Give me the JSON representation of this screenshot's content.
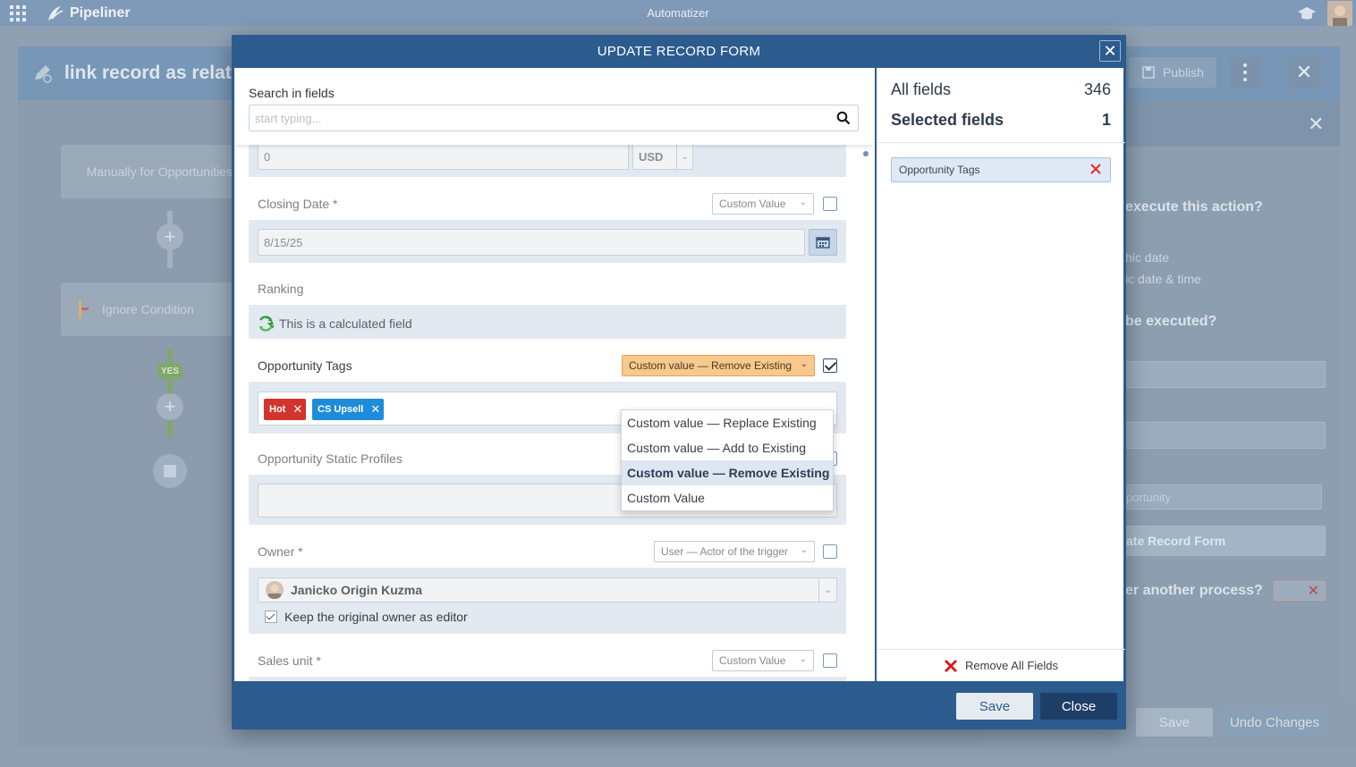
{
  "app": {
    "brand": "Pipeliner",
    "title": "Automatizer"
  },
  "background": {
    "process_title": "link record as related",
    "publish_label": "Publish",
    "nodes": [
      {
        "label": "Manually for Opportunities"
      },
      {
        "label": "Ignore Condition"
      }
    ],
    "yes_label": "YES",
    "right_panel": {
      "q1": "execute this action?",
      "opt1": "hic date",
      "opt2": "ic date & time",
      "q2": "be executed?",
      "field_value": "portunity",
      "action_button": "ate Record Form",
      "q3": "er another process?"
    },
    "save_label": "Save",
    "undo_label": "Undo Changes"
  },
  "modal": {
    "title": "UPDATE RECORD FORM",
    "search": {
      "label": "Search in fields",
      "placeholder": "start typing..."
    },
    "fields": {
      "amount": {
        "value": "0",
        "currency": "USD"
      },
      "closing_date": {
        "label": "Closing Date *",
        "mode": "Custom Value",
        "value": "8/15/25"
      },
      "ranking": {
        "label": "Ranking",
        "calc_text": "This is a calculated field"
      },
      "opportunity_tags": {
        "label": "Opportunity Tags",
        "mode": "Custom value — Remove Existing",
        "tags": [
          {
            "label": "Hot",
            "color": "#d2342d"
          },
          {
            "label": "CS Upsell",
            "color": "#1d8cd9"
          }
        ]
      },
      "static_profiles": {
        "label": "Opportunity Static Profiles"
      },
      "owner": {
        "label": "Owner *",
        "mode": "User — Actor of the trigger",
        "value": "Janicko Origin Kuzma",
        "keep_label": "Keep the original owner as editor"
      },
      "sales_unit": {
        "label": "Sales unit *",
        "mode": "Custom Value"
      }
    },
    "dropdown_options": [
      "Custom value — Replace Existing",
      "Custom value — Add to Existing",
      "Custom value — Remove Existing",
      "Custom Value"
    ],
    "right": {
      "all_fields_label": "All fields",
      "all_fields_count": "346",
      "selected_fields_label": "Selected fields",
      "selected_fields_count": "1",
      "selected": [
        "Opportunity Tags"
      ],
      "remove_all_label": "Remove All Fields"
    },
    "save_label": "Save",
    "close_label": "Close"
  }
}
